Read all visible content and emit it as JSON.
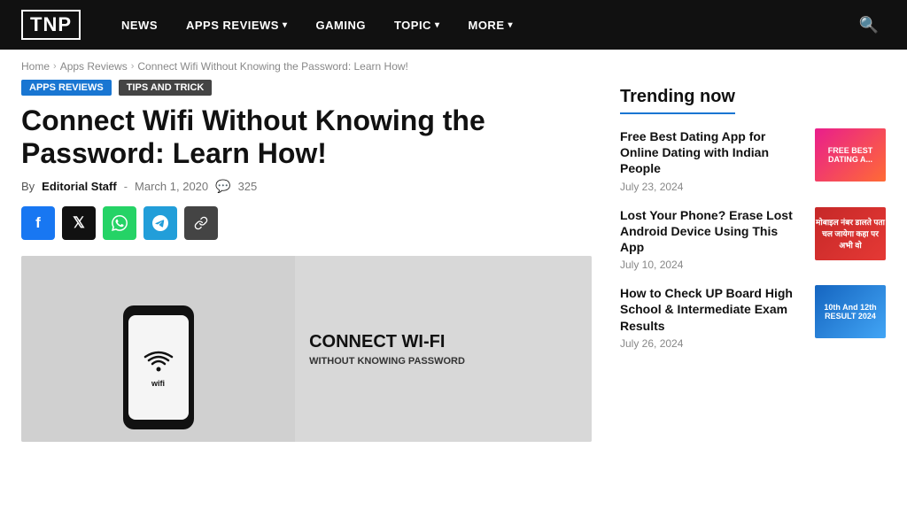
{
  "navbar": {
    "logo": "TNP",
    "links": [
      {
        "label": "NEWS",
        "hasDropdown": false
      },
      {
        "label": "APPS REVIEWS",
        "hasDropdown": true
      },
      {
        "label": "GAMING",
        "hasDropdown": false
      },
      {
        "label": "TOPIC",
        "hasDropdown": true
      },
      {
        "label": "MORE",
        "hasDropdown": true
      }
    ]
  },
  "breadcrumb": {
    "items": [
      "Home",
      "Apps Reviews",
      "Connect Wifi Without Knowing the Password: Learn How!"
    ]
  },
  "article": {
    "tags": [
      "Apps Reviews",
      "Tips And Trick"
    ],
    "title": "Connect Wifi Without Knowing the Password: Learn How!",
    "meta": {
      "by": "By",
      "author": "Editorial Staff",
      "dash": "-",
      "date": "March 1, 2020",
      "comment_count": "325"
    },
    "social": [
      {
        "name": "facebook",
        "symbol": "f"
      },
      {
        "name": "twitter",
        "symbol": "𝕏"
      },
      {
        "name": "whatsapp",
        "symbol": "✔"
      },
      {
        "name": "telegram",
        "symbol": "✈"
      },
      {
        "name": "link",
        "symbol": "🔗"
      }
    ],
    "image": {
      "wifi_label": "wifi",
      "right_title": "CONNECT WI-FI",
      "right_sub": "WITHOUT KNOWING PASSWORD"
    }
  },
  "sidebar": {
    "trending_title": "Trending now",
    "items": [
      {
        "title": "Free Best Dating App for Online Dating with Indian People",
        "date": "July 23, 2024",
        "thumb_text": "FREE\nBEST DATING A..."
      },
      {
        "title": "Lost Your Phone? Erase Lost Android Device Using This App",
        "date": "July 10, 2024",
        "thumb_text": "मोबाइल नंबर डालते\nपता चल जायेगा\nकहा पर\nअभी वो"
      },
      {
        "title": "How to Check UP Board High School & Intermediate Exam Results",
        "date": "July 26, 2024",
        "thumb_text": "10th And 12th\nRESULT 2024"
      }
    ]
  }
}
